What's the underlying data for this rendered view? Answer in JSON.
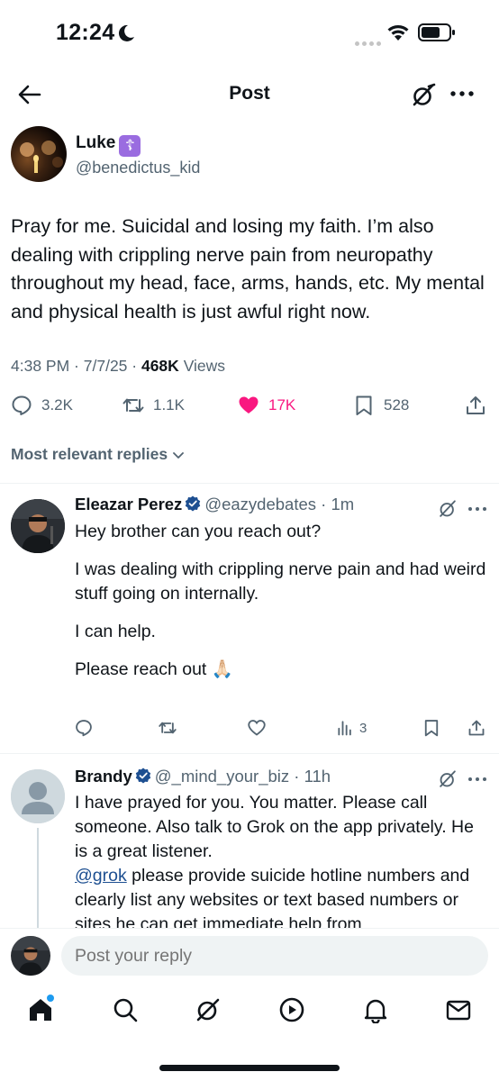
{
  "status_bar": {
    "time": "12:24"
  },
  "header": {
    "title": "Post"
  },
  "post": {
    "author_name": "Luke",
    "author_badge": "☦",
    "author_handle": "@benedictus_kid",
    "text": "Pray for me. Suicidal and losing my faith. I’m also dealing with crippling nerve pain from neuropathy throughout my head, face, arms, hands, etc. My mental and physical health is just awful right now.",
    "time": "4:38 PM",
    "date": "7/7/25",
    "views_count": "468K",
    "views_label": "Views",
    "replies": "3.2K",
    "reposts": "1.1K",
    "likes": "17K",
    "bookmarks": "528"
  },
  "sort_label": "Most relevant replies",
  "replies": [
    {
      "name": "Eleazar Perez",
      "handle": "@eazydebates",
      "time": "1m",
      "paragraphs": [
        "Hey brother can you reach out?",
        "I was dealing with crippling nerve pain and had weird stuff going on internally.",
        "I can help.",
        "Please reach out 🙏🏻"
      ],
      "views": "3"
    },
    {
      "name": "Brandy",
      "handle": "@_mind_your_biz",
      "time": "11h",
      "text_line1": "I have prayed for you. You matter. Please call someone. Also talk to Grok on the app privately. He is a great listener.",
      "mention": "@grok",
      "text_line2": " please provide suicide hotline numbers and clearly list any websites or text based numbers or sites he can get immediate help from"
    }
  ],
  "reply_bar": {
    "placeholder": "Post your reply"
  },
  "colors": {
    "like": "#f91880",
    "verified": "#1d4f91",
    "muted": "#536471",
    "notification_dot": "#1d9bf0"
  },
  "icons": [
    "back-arrow-icon",
    "grok-icon",
    "more-icon",
    "reply-icon",
    "repost-icon",
    "heart-icon",
    "bookmark-icon",
    "share-icon",
    "chevron-down-icon",
    "verified-icon",
    "views-icon",
    "home-icon",
    "search-icon",
    "play-icon",
    "bell-icon",
    "mail-icon"
  ]
}
